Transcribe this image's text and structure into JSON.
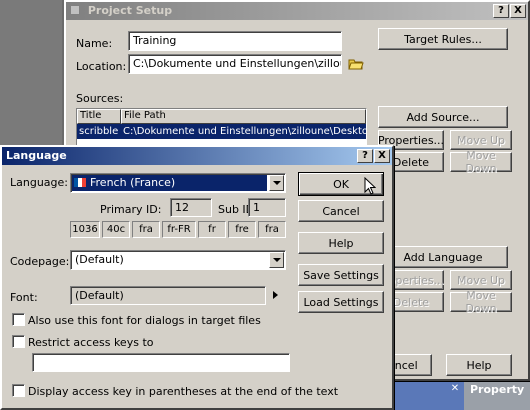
{
  "project_setup": {
    "title": "Project Setup",
    "help_btn": "?",
    "close_btn": "X",
    "name_label": "Name:",
    "name_value": "Training",
    "location_label": "Location:",
    "location_value": "C:\\Dokumente und Einstellungen\\zilloune\\Deskto",
    "target_rules_btn": "Target Rules...",
    "sources_label": "Sources:",
    "sources_columns": [
      "Title",
      "File Path"
    ],
    "sources_rows": [
      {
        "title": "scribble",
        "path": "C:\\Dokumente und Einstellungen\\zilloune\\Desktop\\Passol"
      }
    ],
    "add_source_btn": "Add Source...",
    "properties_btn": "Properties...",
    "move_up_btn": "Move Up",
    "delete_btn": "Delete",
    "move_down_btn": "Move Down",
    "add_language_btn": "Add Language",
    "properties2_btn": "Properties...",
    "move_up2_btn": "Move Up",
    "delete2_btn": "Delete",
    "move_down2_btn": "Move Down",
    "cancel_btn": "Cancel",
    "help_bottom_btn": "Help"
  },
  "background": {
    "property_label": "Property",
    "close_glyph": "✕"
  },
  "language_dialog": {
    "title": "Language",
    "help_btn": "?",
    "close_btn": "X",
    "language_label": "Language:",
    "language_value": "French (France)",
    "primary_id_label": "Primary ID:",
    "primary_id_value": "12",
    "sub_id_label": "Sub ID:",
    "sub_id_value": "1",
    "codes": [
      "1036",
      "40c",
      "fra",
      "fr-FR",
      "fr",
      "fre",
      "fra"
    ],
    "codepage_label": "Codepage:",
    "codepage_value": "(Default)",
    "font_label": "Font:",
    "font_value": "(Default)",
    "also_use_font_label": "Also use this font for dialogs in target files",
    "restrict_keys_label": "Restrict access keys to",
    "restrict_keys_value": "",
    "display_access_key_label": "Display access key in parentheses at the end of the text",
    "ok_btn": "OK",
    "cancel_btn": "Cancel",
    "help_btn_label": "Help",
    "save_settings_btn": "Save Settings",
    "load_settings_btn": "Load Settings"
  },
  "colors": {
    "active_title": "#0a246a",
    "selection": "#0a246a",
    "dialog_face": "#d4d0c8"
  }
}
